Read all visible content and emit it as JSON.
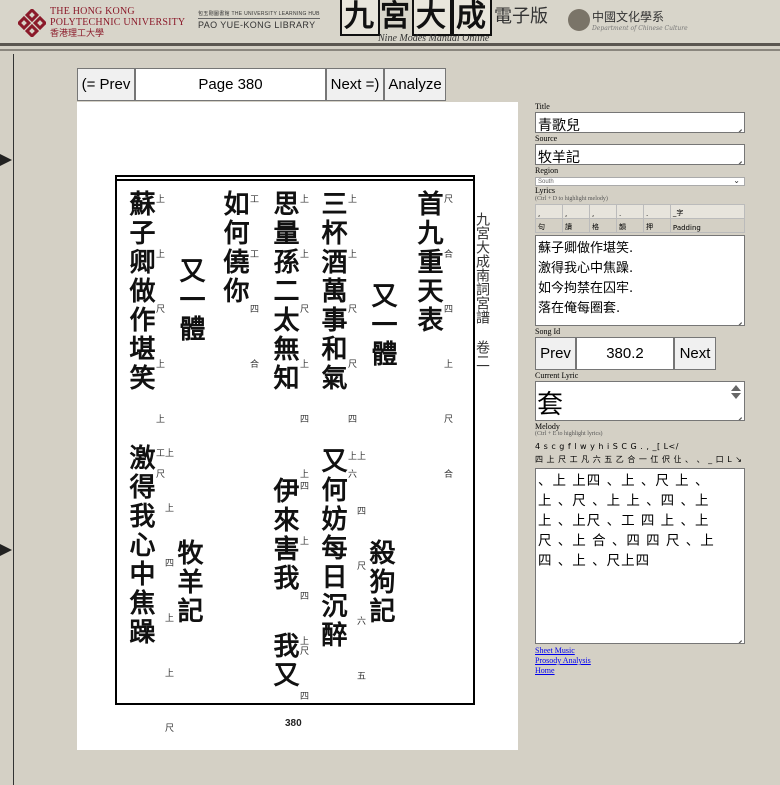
{
  "header": {
    "polyu_line1": "THE HONG KONG",
    "polyu_line2": "POLYTECHNIC UNIVERSITY",
    "polyu_line3": "香港理工大學",
    "library_small": "包玉剛圖書館  THE UNIVERSITY LEARNING HUB",
    "library_big": "PAO YUE-KONG LIBRARY",
    "title_boxed1": "九",
    "title_mid": "宮",
    "title_boxed2": "大",
    "title_boxed3": "成",
    "title_ebook": "電子版",
    "title_sub": "Nine Modes Manual Online",
    "dept_cn": "中國文化學系",
    "dept_en": "Department of Chinese Culture"
  },
  "nav": {
    "prev_label": "(= Prev",
    "page_label": "Page 380",
    "next_label": "Next =)",
    "analyze_label": "Analyze"
  },
  "scan": {
    "page_number": "380",
    "columns": [
      {
        "text": "首九重天表",
        "notes": "尺 合 四 上 尺 合"
      },
      {
        "text": "又一體",
        "notes": ""
      },
      {
        "text": "三杯酒萬事和氣",
        "notes": "上 上 尺 尺 四 六"
      },
      {
        "text": "思量孫二太無知",
        "notes": "上 上 尺 上 四 上"
      },
      {
        "text": "如何僥你",
        "notes": "工 工 四 合"
      },
      {
        "text": "又一體",
        "notes": ""
      },
      {
        "text": "蘇子卿做作堪笑",
        "notes": "上 上 尺 上 上 尺"
      },
      {
        "text": "又何妨每日沉醉",
        "notes": "上 四 尺 六 五 上"
      },
      {
        "text": "伊來害我",
        "notes": "四 上 四 尺"
      },
      {
        "text": "我又",
        "notes": "上 四"
      },
      {
        "text": "激得我心中焦躁",
        "notes": "上 上 四 上 上 尺 工"
      },
      {
        "text": "殺狗記",
        "notes": ""
      },
      {
        "text": "牧羊記",
        "notes": ""
      }
    ],
    "margin_text": "九宮大成南詞宮譜 卷二"
  },
  "form": {
    "title_label": "Title",
    "title_value": "青歌兒",
    "source_label": "Source",
    "source_value": "牧羊記",
    "region_label": "Region",
    "region_value": "South",
    "lyrics_label": "Lyrics",
    "lyrics_hint": "(Ctrl + D to highlight melody)",
    "punct_row1": [
      ",",
      ",",
      ",",
      ".",
      ".",
      "_字"
    ],
    "punct_row2": [
      "句",
      "讀",
      "格",
      "韻",
      "押",
      "Padding"
    ],
    "lyrics_lines": [
      "蘇子卿做作堪笑.",
      "激得我心中焦躁.",
      "如今拘禁在囚牢.",
      "落在俺每圈套."
    ],
    "song_id_label": "Song Id",
    "song_prev": "Prev",
    "song_id_value": "380.2",
    "song_next": "Next",
    "current_lyric_label": "Current Lyric",
    "current_lyric_value": "套",
    "melody_label": "Melody",
    "melody_hint": "(Ctrl + E to highlight lyrics)",
    "melody_keys_row1": "4 s c g f l w y h i S C G . ,  _[ L</",
    "melody_keys_row2": "四 上 尺 工 凡 六 五 乙 合 一 仜 伬 仩 、 、 _ 口 L ↘ ≞",
    "melody_lines": [
      "、上 上四 、上 、尺 上 、",
      "上 、尺 、上 上 、四 、上",
      "上 、上尺 、工 四 上 、上",
      "尺 、上 合 、四 四 尺 、上",
      "四 、上 、尺上四"
    ],
    "links": [
      "Sheet Music",
      "Prosody Analysis",
      "Home"
    ]
  }
}
